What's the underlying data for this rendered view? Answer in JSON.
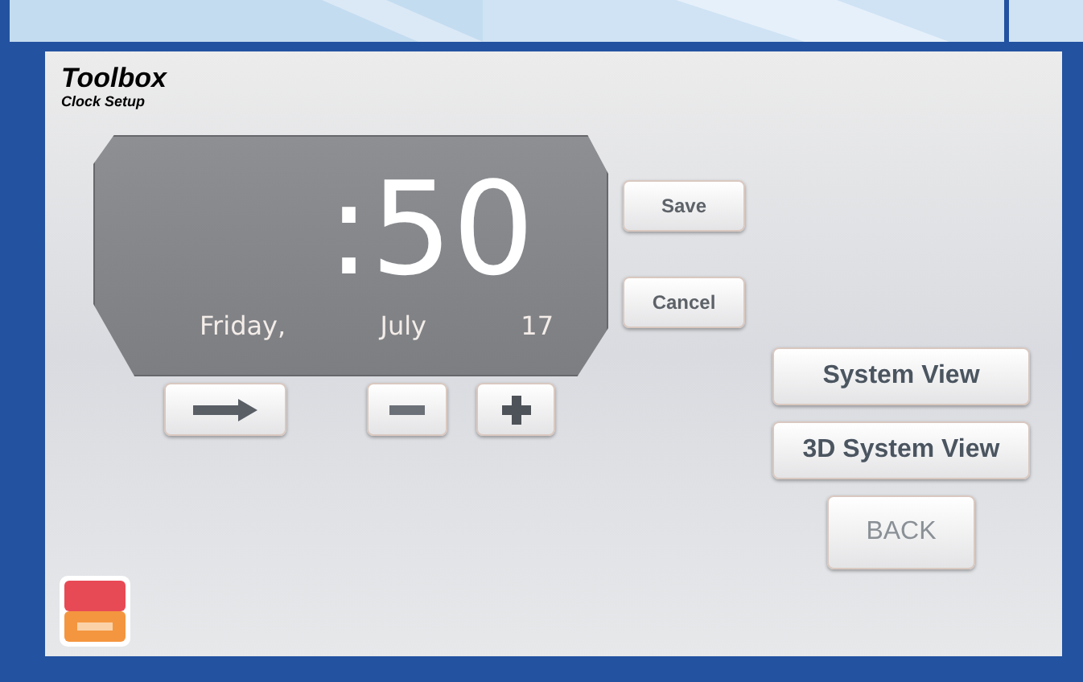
{
  "header": {
    "title": "Toolbox",
    "subtitle": "Clock Setup"
  },
  "clock": {
    "time": ":50",
    "weekday": "Friday,",
    "month": "July",
    "day": "17"
  },
  "edit_buttons": [
    {
      "label": "Save",
      "disabled": false
    },
    {
      "label": "Cancel",
      "disabled": false
    }
  ],
  "adjust_buttons": [
    {
      "kind": "next"
    },
    {
      "kind": "minus"
    },
    {
      "kind": "plus"
    }
  ],
  "nav_buttons": [
    {
      "label": "System View",
      "disabled": false
    },
    {
      "label": "3D System View",
      "disabled": false
    },
    {
      "label": "BACK",
      "disabled": true
    }
  ]
}
